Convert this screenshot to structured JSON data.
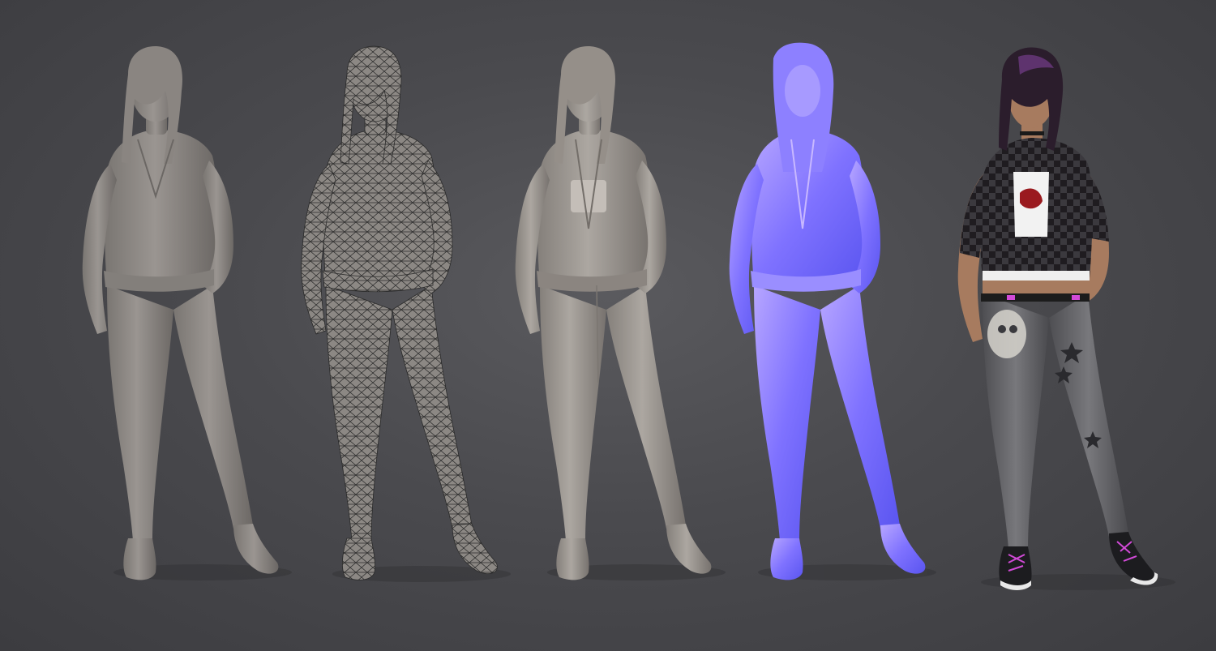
{
  "scene": {
    "background_color": "#4b4b4f",
    "panels": [
      {
        "id": "base-mesh",
        "style": "untextured",
        "fill": "#8f8a86",
        "shade": "#6d6966"
      },
      {
        "id": "wireframe",
        "style": "wireframe",
        "fill": "#8f8a86",
        "shade": "#6d6966",
        "line": "#2a2a2a"
      },
      {
        "id": "high-poly-sculpt",
        "style": "sculpt",
        "fill": "#a39e98",
        "shade": "#7a7570"
      },
      {
        "id": "normal-map",
        "style": "normal-map",
        "fill": "#8a7cff",
        "shade": "#5a4ee0",
        "highlight": "#c8b8ff"
      },
      {
        "id": "final-textured",
        "style": "textured",
        "hair": "#2b1d2c",
        "skin": "#a77b5f",
        "jacket": "#232024",
        "check": "#3a3a3e",
        "shirt": "#f2f2f2",
        "print": "#9a1a1f",
        "jeans": "#6a6a6e",
        "shoe": "#1c1c1f",
        "laces": "#d24ad8",
        "belt": "#1c1c1c"
      }
    ]
  }
}
